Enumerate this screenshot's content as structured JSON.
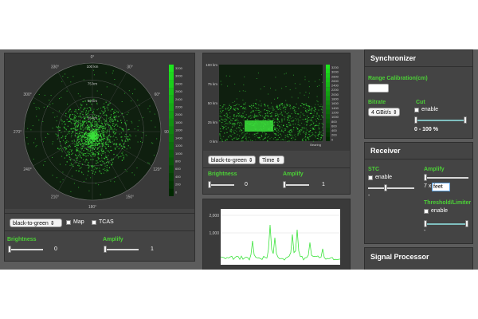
{
  "ppi": {
    "bearings": [
      "0°",
      "30°",
      "60°",
      "90°",
      "120°",
      "150°",
      "180°",
      "210°",
      "240°",
      "270°",
      "300°",
      "330°"
    ],
    "ranges": [
      "100 km",
      "75 km",
      "50 km",
      "25 km"
    ],
    "colorbar": [
      "3200",
      "3000",
      "2800",
      "2600",
      "2400",
      "2200",
      "2000",
      "1800",
      "1600",
      "1400",
      "1200",
      "1000",
      "800",
      "600",
      "400",
      "200",
      "0"
    ],
    "colormap": "black-to-green",
    "map_label": "Map",
    "tcas_label": "TCAS",
    "brightness_label": "Brightness",
    "brightness_value": "0",
    "amplify_label": "Amplify",
    "amplify_value": "1"
  },
  "waterfall": {
    "y_ticks": [
      "100 km",
      "75 km",
      "50 km",
      "25 km",
      "0 km"
    ],
    "colorbar": [
      "3200",
      "3000",
      "2800",
      "2600",
      "2400",
      "2200",
      "2000",
      "1800",
      "1600",
      "1400",
      "1200",
      "1000",
      "800",
      "600",
      "400",
      "200",
      "0"
    ],
    "corner_label": "Bearing",
    "colormap": "black-to-green",
    "axis_mode": "Time",
    "brightness_label": "Brightness",
    "brightness_value": "0",
    "amplify_label": "Amplify",
    "amplify_value": "1"
  },
  "scope": {
    "y_ticks": [
      "2,000",
      "1,000"
    ]
  },
  "synchronizer": {
    "title": "Synchronizer",
    "range_cal_label": "Range Calibration(cm)",
    "range_cal_value": "",
    "bitrate_label": "Bitrate",
    "bitrate_value": "4 GBit/s",
    "cut_label": "Cut",
    "cut_enable": "enable",
    "cut_range": "0 - 100 %"
  },
  "receiver": {
    "title": "Receiver",
    "stc_label": "STC",
    "stc_enable": "enable",
    "stc_value": "-",
    "amplify_label": "Amplify",
    "amplify_prefix": "7 x",
    "amplify_value": "feet",
    "threshold_label": "Threshold/Limiter",
    "threshold_enable": "enable",
    "threshold_value": "-"
  },
  "signal_processor": {
    "title": "Signal Processor"
  },
  "colors": {
    "accent": "#4cd137",
    "panel": "#444444",
    "frame": "#5c5c5c",
    "plot_bg": "#0f1f0f",
    "echo": "#3be33b"
  }
}
